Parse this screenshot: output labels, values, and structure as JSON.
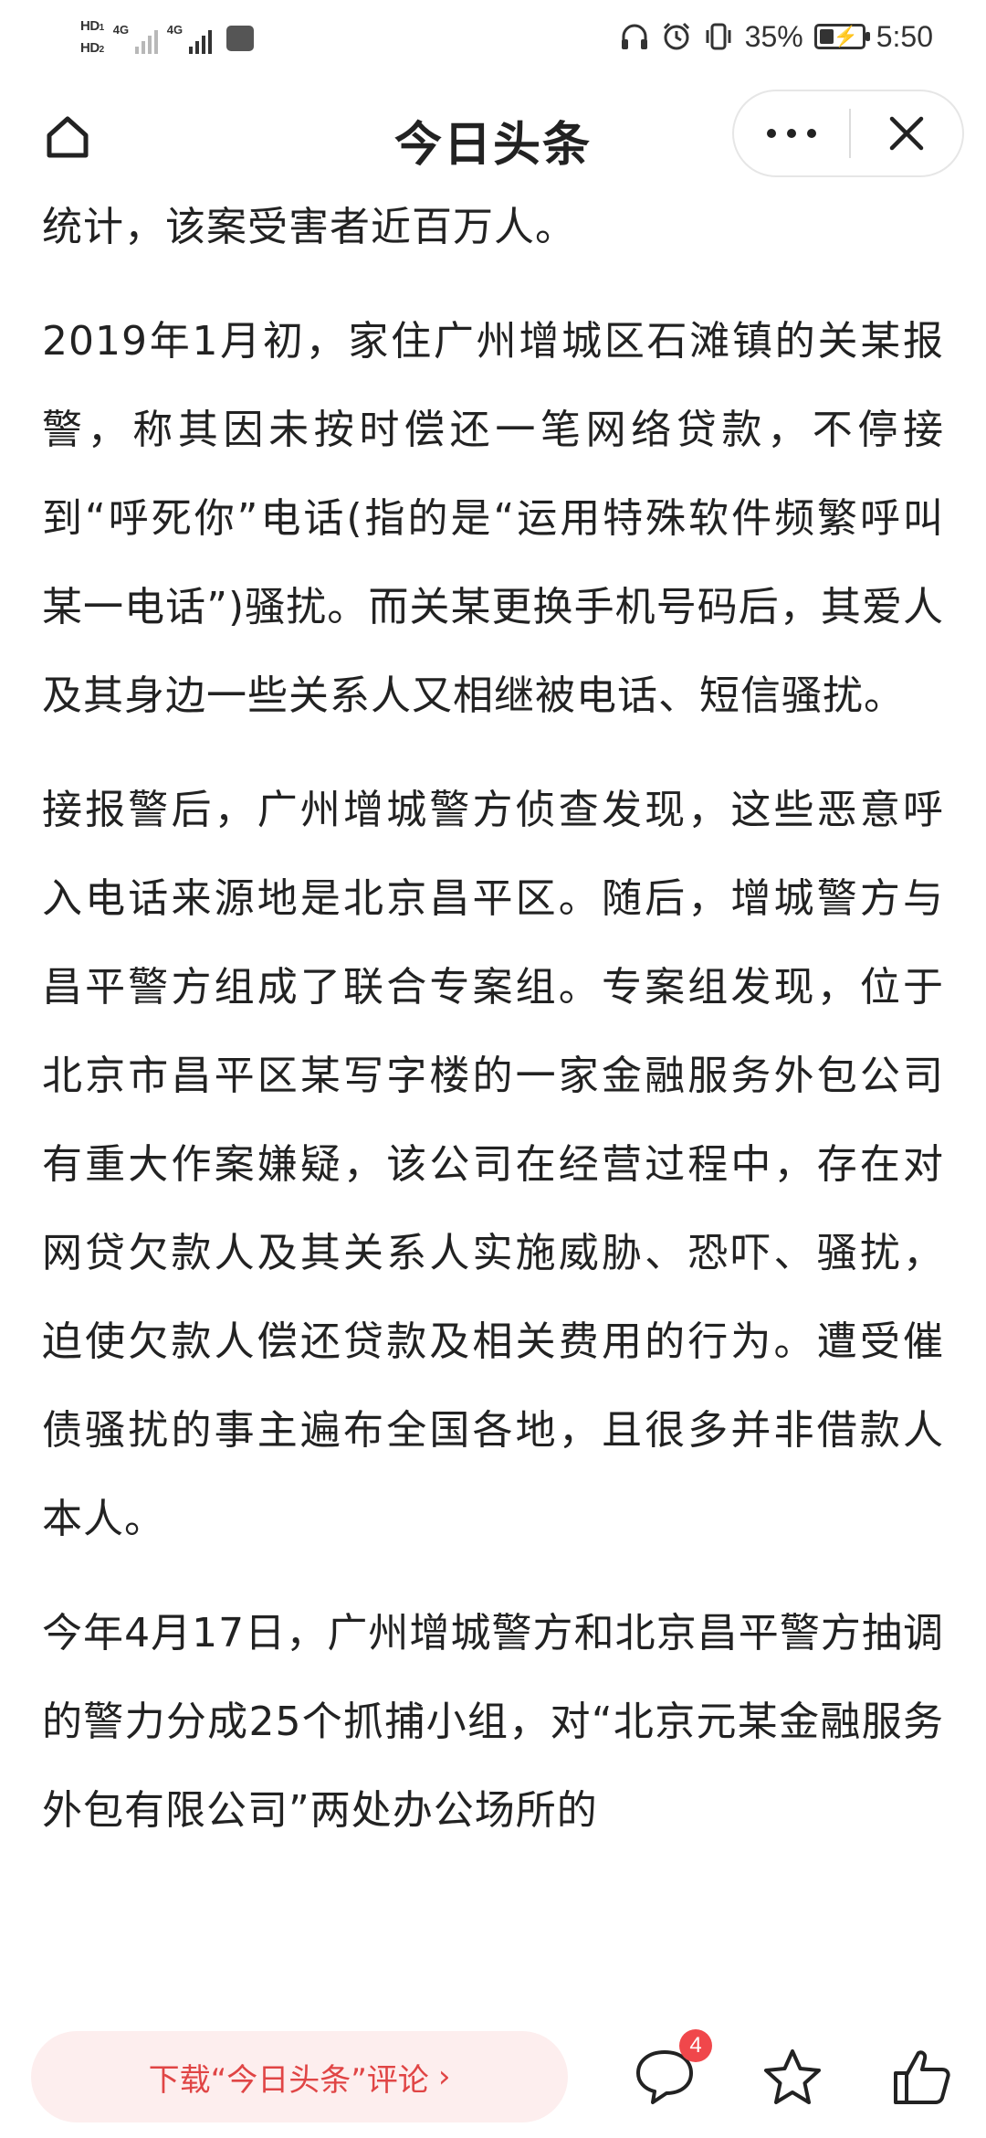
{
  "status_bar": {
    "hd1": "HD",
    "hd1_sub": "1",
    "hd2": "HD",
    "hd2_sub": "2",
    "net1": "4G",
    "net2": "4G",
    "battery_percent": "35%",
    "battery_level": 0.35,
    "time": "5:50"
  },
  "nav": {
    "title": "今日头条",
    "home_icon": "home-icon",
    "more_icon": "more-horizontal-icon",
    "close_icon": "close-icon"
  },
  "article": {
    "paragraphs": [
      "统计，该案受害者近百万人。",
      "2019年1月初，家住广州增城区石滩镇的关某报警，称其因未按时偿还一笔网络贷款，不停接到“呼死你”电话(指的是“运用特殊软件频繁呼叫某一电话”)骚扰。而关某更换手机号码后，其爱人及其身边一些关系人又相继被电话、短信骚扰。",
      "接报警后，广州增城警方侦查发现，这些恶意呼入电话来源地是北京昌平区。随后，增城警方与昌平警方组成了联合专案组。专案组发现，位于北京市昌平区某写字楼的一家金融服务外包公司有重大作案嫌疑，该公司在经营过程中，存在对网贷欠款人及其关系人实施威胁、恐吓、骚扰，迫使欠款人偿还贷款及相关费用的行为。遭受催债骚扰的事主遍布全国各地，且很多并非借款人本人。",
      "今年4月17日，广州增城警方和北京昌平警方抽调的警力分成25个抓捕小组，对“北京元某金融服务外包有限公司”两处办公场所的"
    ]
  },
  "bottom_bar": {
    "comment_prompt": "下载“今日头条”评论",
    "comment_count": "4",
    "comment_icon": "comment-bubble-icon",
    "favorite_icon": "star-icon",
    "like_icon": "thumbs-up-icon"
  },
  "colors": {
    "accent_red": "#e04545",
    "pill_bg": "#fdeeee",
    "badge_red": "#f0474b",
    "text": "#222222"
  }
}
